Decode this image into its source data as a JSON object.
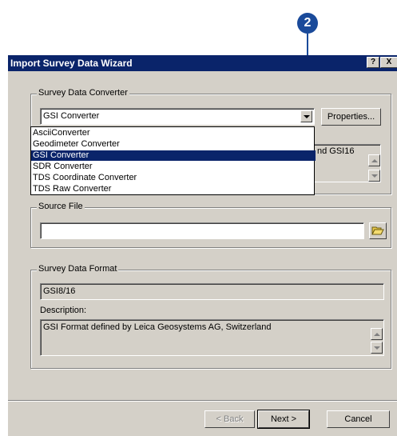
{
  "callout": {
    "number": "2"
  },
  "window": {
    "title": "Import Survey Data Wizard",
    "help_label": "?",
    "close_label": "X"
  },
  "converter_group": {
    "legend": "Survey Data Converter",
    "selected": "GSI Converter",
    "properties_label": "Properties...",
    "hidden_text": "nd GSI16",
    "options": [
      "AsciiConverter",
      "Geodimeter Converter",
      "GSI Converter",
      "SDR Converter",
      "TDS Coordinate Converter",
      "TDS Raw Converter"
    ]
  },
  "source_group": {
    "legend": "Source File",
    "value": ""
  },
  "format_group": {
    "legend": "Survey Data Format",
    "format_value": "GSI8/16",
    "description_label": "Description:",
    "description_text": "GSI Format defined by Leica Geosystems AG, Switzerland"
  },
  "buttons": {
    "back": "< Back",
    "next": "Next >",
    "cancel": "Cancel"
  },
  "colors": {
    "title_bar": "#0a246a",
    "dialog_face": "#d4d0c8",
    "callout": "#1a4a9a",
    "selection": "#0a246a"
  }
}
